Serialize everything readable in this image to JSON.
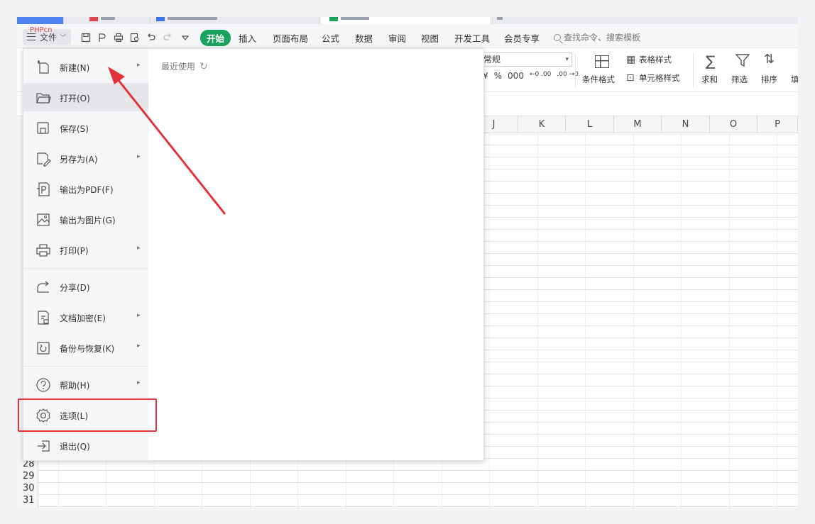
{
  "watermark": "PHPcn",
  "menubar": {
    "file_label": "文件",
    "tabs": [
      "开始",
      "插入",
      "页面布局",
      "公式",
      "数据",
      "审阅",
      "视图",
      "开发工具",
      "会员专享"
    ],
    "search_label": "查找命令、搜索模板"
  },
  "ribbon": {
    "number_format": "常规",
    "number_symbols": [
      "¥",
      "%",
      "000",
      "←0 .00",
      ".00 →0"
    ],
    "conditional_format": "条件格式",
    "table_style": "表格样式",
    "cell_style": "单元格样式",
    "sum": "求和",
    "filter": "筛选",
    "sort": "排序",
    "fill": "填"
  },
  "sheet": {
    "columns": [
      "J",
      "K",
      "L",
      "M",
      "N",
      "O",
      "P"
    ],
    "rows": [
      "28",
      "29",
      "30",
      "31"
    ]
  },
  "file_menu": {
    "recent_label": "最近使用",
    "items": [
      {
        "label": "新建(N)",
        "icon": "new-file-icon",
        "submenu": true
      },
      {
        "label": "打开(O)",
        "icon": "folder-open-icon",
        "submenu": false
      },
      {
        "label": "保存(S)",
        "icon": "save-icon",
        "submenu": false
      },
      {
        "label": "另存为(A)",
        "icon": "save-as-icon",
        "submenu": true
      },
      {
        "label": "输出为PDF(F)",
        "icon": "pdf-export-icon",
        "submenu": false
      },
      {
        "label": "输出为图片(G)",
        "icon": "image-export-icon",
        "submenu": false
      },
      {
        "label": "打印(P)",
        "icon": "printer-icon",
        "submenu": true
      },
      {
        "label": "分享(D)",
        "icon": "share-icon",
        "submenu": false
      },
      {
        "label": "文档加密(E)",
        "icon": "lock-document-icon",
        "submenu": true
      },
      {
        "label": "备份与恢复(K)",
        "icon": "backup-restore-icon",
        "submenu": true
      },
      {
        "label": "帮助(H)",
        "icon": "help-icon",
        "submenu": true
      },
      {
        "label": "选项(L)",
        "icon": "gear-icon",
        "submenu": false
      },
      {
        "label": "退出(Q)",
        "icon": "exit-icon",
        "submenu": false
      }
    ]
  },
  "colors": {
    "accent": "#1aa35c",
    "annotation": "#e3323a",
    "menu_bg": "#f5f6f8",
    "hover_bg": "#e4e6ea"
  }
}
